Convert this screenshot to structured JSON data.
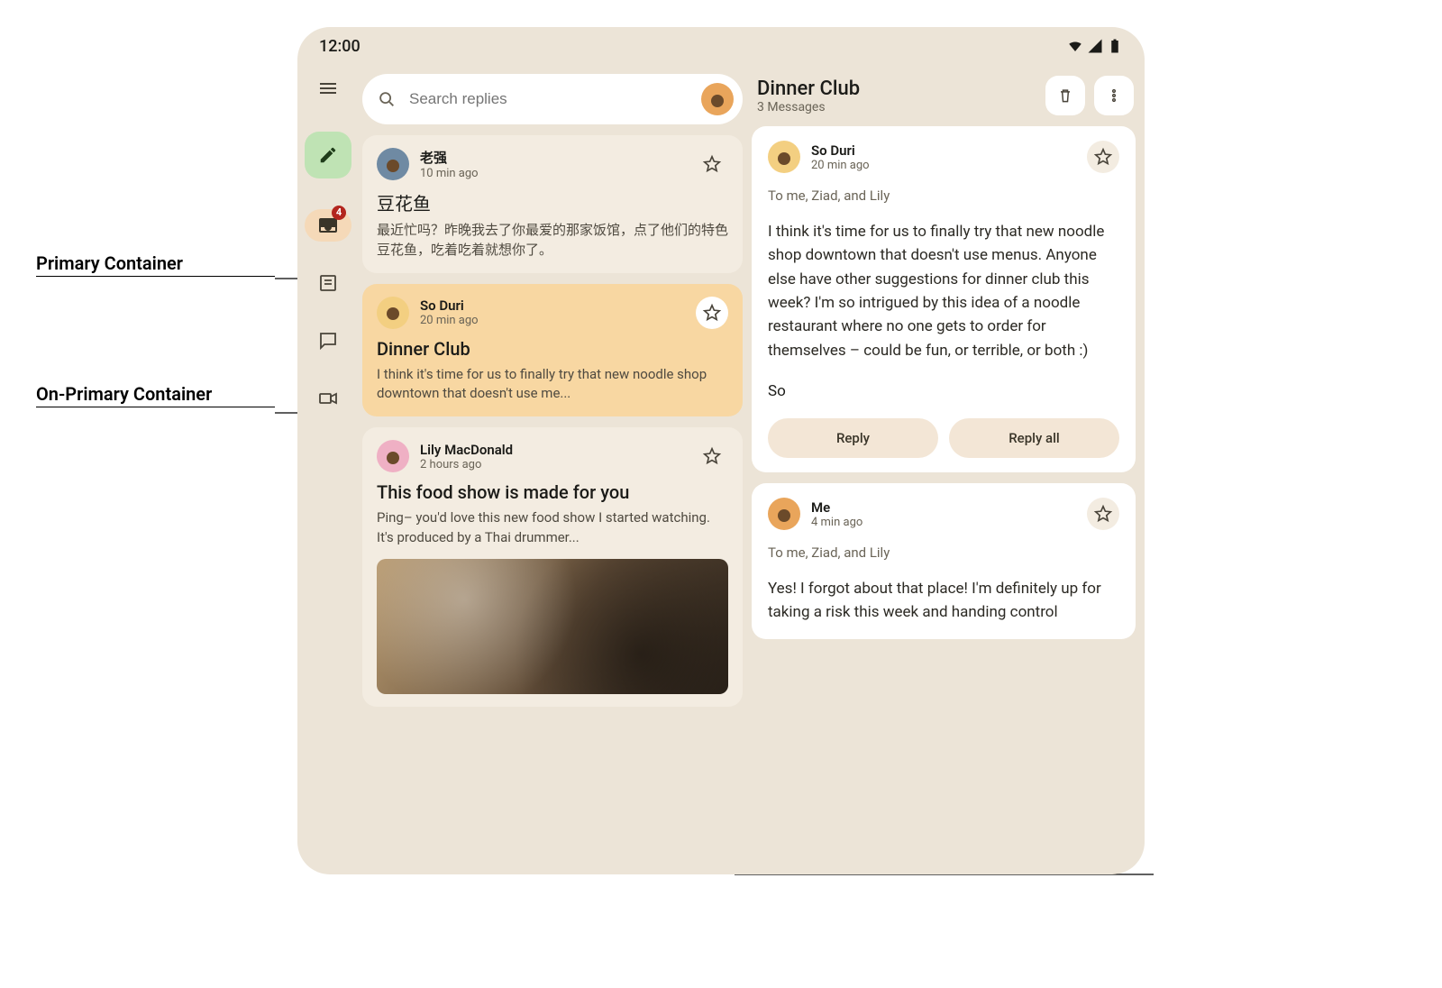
{
  "annotations": {
    "primary": "Primary Container",
    "onPrimary": "On-Primary Container"
  },
  "statusbar": {
    "time": "12:00"
  },
  "rail": {
    "inbox_badge": "4"
  },
  "search": {
    "placeholder": "Search replies"
  },
  "threads": [
    {
      "sender": "老强",
      "ago": "10 min ago",
      "subject": "豆花鱼",
      "preview": "最近忙吗？昨晚我去了你最爱的那家饭馆，点了他们的特色豆花鱼，吃着吃着就想你了。"
    },
    {
      "sender": "So Duri",
      "ago": "20 min ago",
      "subject": "Dinner Club",
      "preview": "I think it's time for us to finally try that new noodle shop downtown that doesn't use me..."
    },
    {
      "sender": "Lily MacDonald",
      "ago": "2 hours ago",
      "subject": "This food show is made for you",
      "preview": "Ping– you'd love this new food show I started watching. It's produced by a Thai drummer..."
    }
  ],
  "detail": {
    "title": "Dinner Club",
    "count": "3 Messages",
    "messages": [
      {
        "sender": "So Duri",
        "ago": "20 min ago",
        "to": "To me, Ziad, and Lily",
        "body": "I think it's time for us to finally try that new noodle shop downtown that doesn't use menus. Anyone else have other suggestions for dinner club this week? I'm so intrigued by this idea of a noodle restaurant where no one gets to order for themselves – could be fun, or terrible, or both :)",
        "signature": "So",
        "reply": "Reply",
        "replyAll": "Reply all"
      },
      {
        "sender": "Me",
        "ago": "4 min ago",
        "to": "To me, Ziad, and Lily",
        "body": "Yes! I forgot about that place! I'm definitely up for taking a risk this week and handing control"
      }
    ]
  }
}
